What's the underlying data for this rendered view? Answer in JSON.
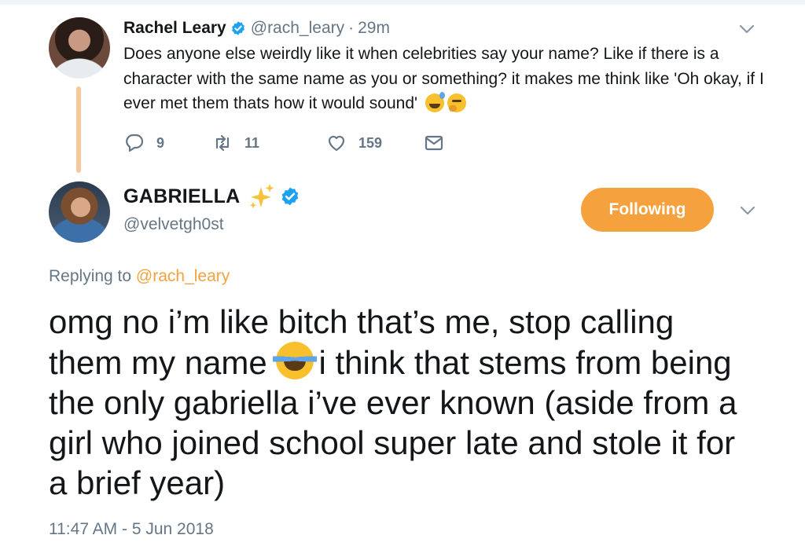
{
  "parent_tweet": {
    "author_name": "Rachel Leary",
    "handle": "@rach_leary",
    "separator": "·",
    "time": "29m",
    "text": "Does anyone else weirdly like it when celebrities say your name? Like if there is a character with the same name as you or something? it makes me think like 'Oh okay, if I ever met them thats how it would sound'",
    "reply_count": "9",
    "retweet_count": "11",
    "like_count": "159"
  },
  "main_tweet": {
    "author_name": "GABRIELLA",
    "handle": "@velvetgh0st",
    "follow_label": "Following",
    "replying_prefix": "Replying to",
    "replying_to": "@rach_leary",
    "text_part1": "omg no i’m like bitch that’s me, stop calling them my name",
    "text_part2": "i think that stems from being the only gabriella i’ve ever known (aside from a girl who joined school super late and stole it for a brief year)",
    "timestamp": "11:47 AM - 5 Jun 2018"
  },
  "colors": {
    "accent": "#f5a23e",
    "thread_line": "#f8c89c",
    "verified": "#1da1f2",
    "muted": "#657786",
    "text": "#14171a"
  },
  "icons": [
    "verified-badge-icon",
    "chevron-down-icon",
    "reply-icon",
    "retweet-icon",
    "like-icon",
    "direct-message-icon",
    "sparkles-icon",
    "emoji-sweat-smile-icon",
    "emoji-thinking-icon",
    "emoji-tears-of-joy-icon"
  ]
}
